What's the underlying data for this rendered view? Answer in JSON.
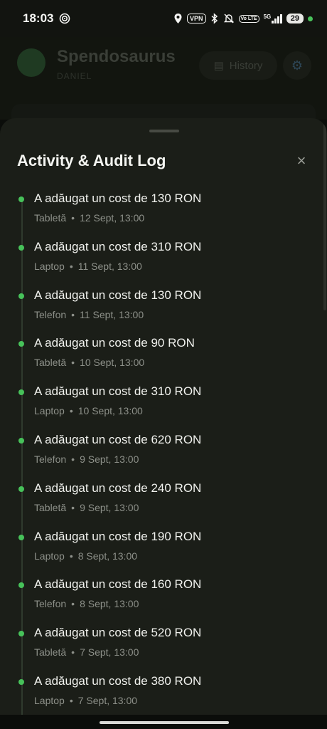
{
  "status_bar": {
    "time": "18:03",
    "vpn": "VPN",
    "volte": "Vo LTE",
    "network": "5G",
    "battery": "29"
  },
  "app_header": {
    "app_name": "Spendosaurus",
    "user": "DANIEL",
    "history_label": "History"
  },
  "sheet": {
    "title": "Activity & Audit Log",
    "close_label": "×",
    "entries": [
      {
        "text": "A adăugat un cost de 130 RON",
        "device": "Tabletă",
        "date": "12 Sept, 13:00"
      },
      {
        "text": "A adăugat un cost de 310 RON",
        "device": "Laptop",
        "date": "11 Sept, 13:00"
      },
      {
        "text": "A adăugat un cost de 130 RON",
        "device": "Telefon",
        "date": "11 Sept, 13:00"
      },
      {
        "text": "A adăugat un cost de 90 RON",
        "device": "Tabletă",
        "date": "10 Sept, 13:00"
      },
      {
        "text": "A adăugat un cost de 310 RON",
        "device": "Laptop",
        "date": "10 Sept, 13:00"
      },
      {
        "text": "A adăugat un cost de 620 RON",
        "device": "Telefon",
        "date": "9 Sept, 13:00"
      },
      {
        "text": "A adăugat un cost de 240 RON",
        "device": "Tabletă",
        "date": "9 Sept, 13:00"
      },
      {
        "text": "A adăugat un cost de 190 RON",
        "device": "Laptop",
        "date": "8 Sept, 13:00"
      },
      {
        "text": "A adăugat un cost de 160 RON",
        "device": "Telefon",
        "date": "8 Sept, 13:00"
      },
      {
        "text": "A adăugat un cost de 520 RON",
        "device": "Tabletă",
        "date": "7 Sept, 13:00"
      },
      {
        "text": "A adăugat un cost de 380 RON",
        "device": "Laptop",
        "date": "7 Sept, 13:00"
      }
    ]
  },
  "colors": {
    "accent_dot": "#47c25a",
    "sheet_bg": "#1b1e18"
  }
}
